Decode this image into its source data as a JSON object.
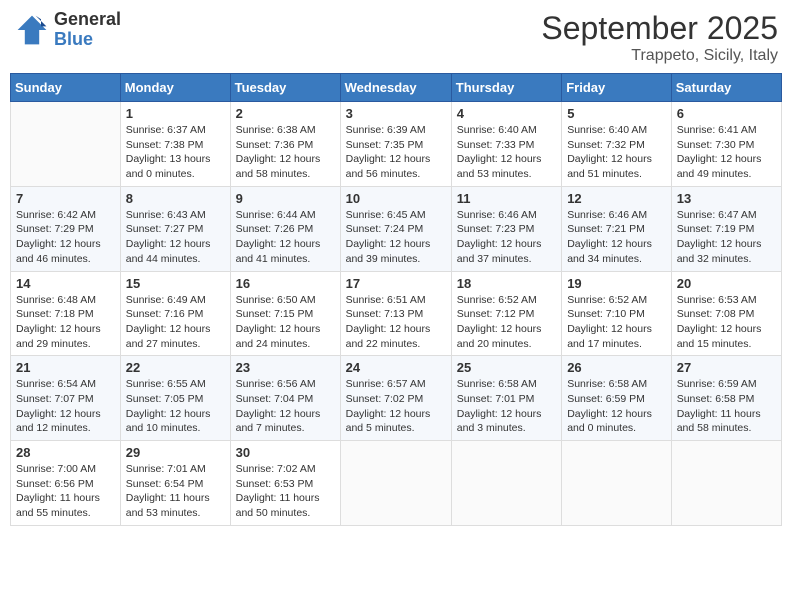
{
  "header": {
    "logo_line1": "General",
    "logo_line2": "Blue",
    "month": "September 2025",
    "location": "Trappeto, Sicily, Italy"
  },
  "days_of_week": [
    "Sunday",
    "Monday",
    "Tuesday",
    "Wednesday",
    "Thursday",
    "Friday",
    "Saturday"
  ],
  "weeks": [
    [
      {
        "day": "",
        "sunrise": "",
        "sunset": "",
        "daylight": ""
      },
      {
        "day": "1",
        "sunrise": "Sunrise: 6:37 AM",
        "sunset": "Sunset: 7:38 PM",
        "daylight": "Daylight: 13 hours and 0 minutes."
      },
      {
        "day": "2",
        "sunrise": "Sunrise: 6:38 AM",
        "sunset": "Sunset: 7:36 PM",
        "daylight": "Daylight: 12 hours and 58 minutes."
      },
      {
        "day": "3",
        "sunrise": "Sunrise: 6:39 AM",
        "sunset": "Sunset: 7:35 PM",
        "daylight": "Daylight: 12 hours and 56 minutes."
      },
      {
        "day": "4",
        "sunrise": "Sunrise: 6:40 AM",
        "sunset": "Sunset: 7:33 PM",
        "daylight": "Daylight: 12 hours and 53 minutes."
      },
      {
        "day": "5",
        "sunrise": "Sunrise: 6:40 AM",
        "sunset": "Sunset: 7:32 PM",
        "daylight": "Daylight: 12 hours and 51 minutes."
      },
      {
        "day": "6",
        "sunrise": "Sunrise: 6:41 AM",
        "sunset": "Sunset: 7:30 PM",
        "daylight": "Daylight: 12 hours and 49 minutes."
      }
    ],
    [
      {
        "day": "7",
        "sunrise": "Sunrise: 6:42 AM",
        "sunset": "Sunset: 7:29 PM",
        "daylight": "Daylight: 12 hours and 46 minutes."
      },
      {
        "day": "8",
        "sunrise": "Sunrise: 6:43 AM",
        "sunset": "Sunset: 7:27 PM",
        "daylight": "Daylight: 12 hours and 44 minutes."
      },
      {
        "day": "9",
        "sunrise": "Sunrise: 6:44 AM",
        "sunset": "Sunset: 7:26 PM",
        "daylight": "Daylight: 12 hours and 41 minutes."
      },
      {
        "day": "10",
        "sunrise": "Sunrise: 6:45 AM",
        "sunset": "Sunset: 7:24 PM",
        "daylight": "Daylight: 12 hours and 39 minutes."
      },
      {
        "day": "11",
        "sunrise": "Sunrise: 6:46 AM",
        "sunset": "Sunset: 7:23 PM",
        "daylight": "Daylight: 12 hours and 37 minutes."
      },
      {
        "day": "12",
        "sunrise": "Sunrise: 6:46 AM",
        "sunset": "Sunset: 7:21 PM",
        "daylight": "Daylight: 12 hours and 34 minutes."
      },
      {
        "day": "13",
        "sunrise": "Sunrise: 6:47 AM",
        "sunset": "Sunset: 7:19 PM",
        "daylight": "Daylight: 12 hours and 32 minutes."
      }
    ],
    [
      {
        "day": "14",
        "sunrise": "Sunrise: 6:48 AM",
        "sunset": "Sunset: 7:18 PM",
        "daylight": "Daylight: 12 hours and 29 minutes."
      },
      {
        "day": "15",
        "sunrise": "Sunrise: 6:49 AM",
        "sunset": "Sunset: 7:16 PM",
        "daylight": "Daylight: 12 hours and 27 minutes."
      },
      {
        "day": "16",
        "sunrise": "Sunrise: 6:50 AM",
        "sunset": "Sunset: 7:15 PM",
        "daylight": "Daylight: 12 hours and 24 minutes."
      },
      {
        "day": "17",
        "sunrise": "Sunrise: 6:51 AM",
        "sunset": "Sunset: 7:13 PM",
        "daylight": "Daylight: 12 hours and 22 minutes."
      },
      {
        "day": "18",
        "sunrise": "Sunrise: 6:52 AM",
        "sunset": "Sunset: 7:12 PM",
        "daylight": "Daylight: 12 hours and 20 minutes."
      },
      {
        "day": "19",
        "sunrise": "Sunrise: 6:52 AM",
        "sunset": "Sunset: 7:10 PM",
        "daylight": "Daylight: 12 hours and 17 minutes."
      },
      {
        "day": "20",
        "sunrise": "Sunrise: 6:53 AM",
        "sunset": "Sunset: 7:08 PM",
        "daylight": "Daylight: 12 hours and 15 minutes."
      }
    ],
    [
      {
        "day": "21",
        "sunrise": "Sunrise: 6:54 AM",
        "sunset": "Sunset: 7:07 PM",
        "daylight": "Daylight: 12 hours and 12 minutes."
      },
      {
        "day": "22",
        "sunrise": "Sunrise: 6:55 AM",
        "sunset": "Sunset: 7:05 PM",
        "daylight": "Daylight: 12 hours and 10 minutes."
      },
      {
        "day": "23",
        "sunrise": "Sunrise: 6:56 AM",
        "sunset": "Sunset: 7:04 PM",
        "daylight": "Daylight: 12 hours and 7 minutes."
      },
      {
        "day": "24",
        "sunrise": "Sunrise: 6:57 AM",
        "sunset": "Sunset: 7:02 PM",
        "daylight": "Daylight: 12 hours and 5 minutes."
      },
      {
        "day": "25",
        "sunrise": "Sunrise: 6:58 AM",
        "sunset": "Sunset: 7:01 PM",
        "daylight": "Daylight: 12 hours and 3 minutes."
      },
      {
        "day": "26",
        "sunrise": "Sunrise: 6:58 AM",
        "sunset": "Sunset: 6:59 PM",
        "daylight": "Daylight: 12 hours and 0 minutes."
      },
      {
        "day": "27",
        "sunrise": "Sunrise: 6:59 AM",
        "sunset": "Sunset: 6:58 PM",
        "daylight": "Daylight: 11 hours and 58 minutes."
      }
    ],
    [
      {
        "day": "28",
        "sunrise": "Sunrise: 7:00 AM",
        "sunset": "Sunset: 6:56 PM",
        "daylight": "Daylight: 11 hours and 55 minutes."
      },
      {
        "day": "29",
        "sunrise": "Sunrise: 7:01 AM",
        "sunset": "Sunset: 6:54 PM",
        "daylight": "Daylight: 11 hours and 53 minutes."
      },
      {
        "day": "30",
        "sunrise": "Sunrise: 7:02 AM",
        "sunset": "Sunset: 6:53 PM",
        "daylight": "Daylight: 11 hours and 50 minutes."
      },
      {
        "day": "",
        "sunrise": "",
        "sunset": "",
        "daylight": ""
      },
      {
        "day": "",
        "sunrise": "",
        "sunset": "",
        "daylight": ""
      },
      {
        "day": "",
        "sunrise": "",
        "sunset": "",
        "daylight": ""
      },
      {
        "day": "",
        "sunrise": "",
        "sunset": "",
        "daylight": ""
      }
    ]
  ]
}
